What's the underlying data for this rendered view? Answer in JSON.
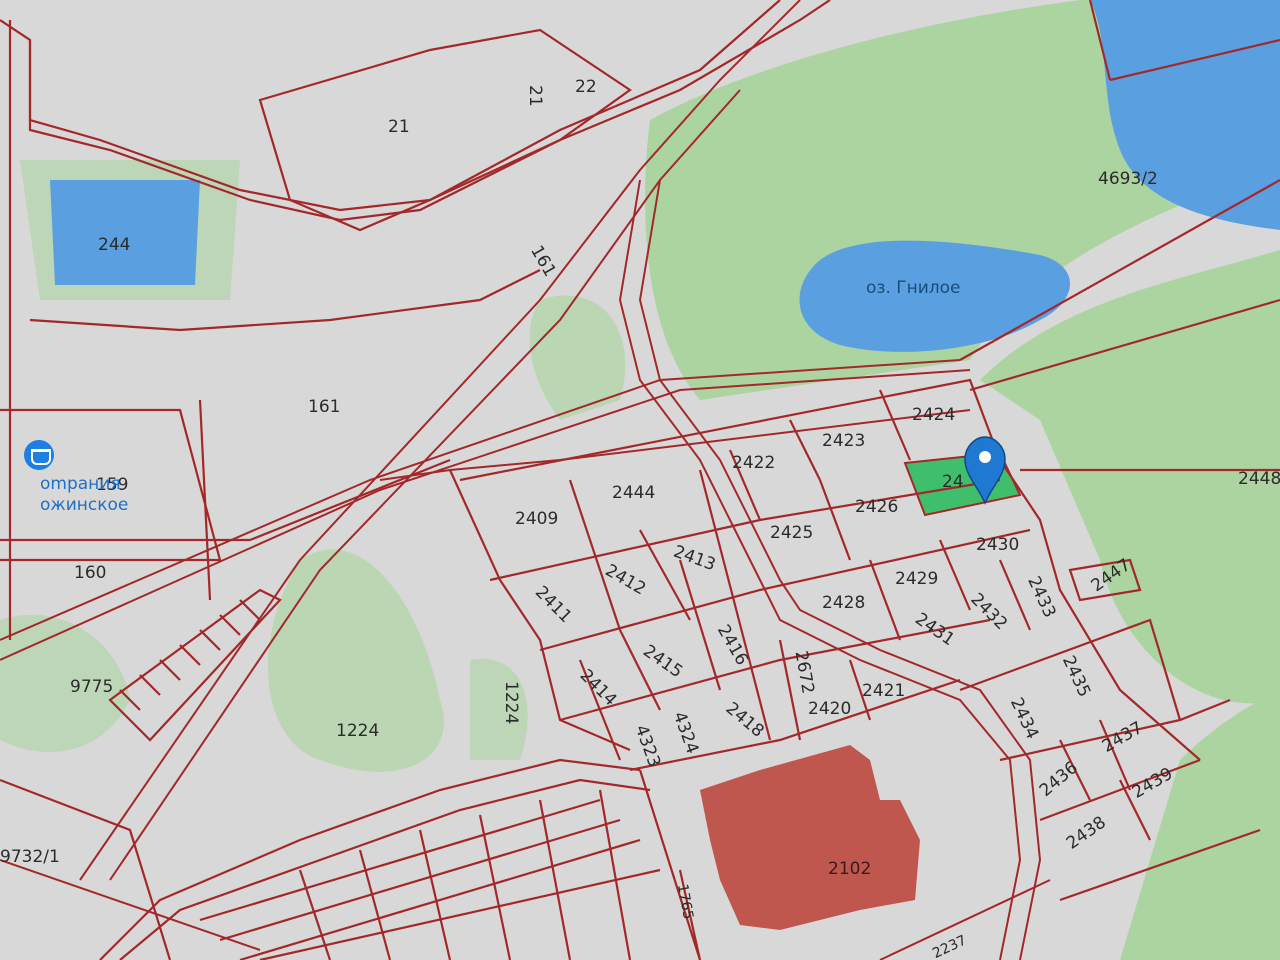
{
  "map": {
    "poi": {
      "name_line1": "ompания",
      "name_line2": "ожинское",
      "icon": "shopping-basket-icon"
    },
    "water_labels": {
      "lake": "оз. Гнилое"
    },
    "parcels": {
      "p21a": "21",
      "p21b": "21",
      "p22": "22",
      "p244": "244",
      "p161a": "161",
      "p161b": "161",
      "p159": "159",
      "p160": "160",
      "p9775": "9775",
      "p1224a": "1224",
      "p1224b": "1224",
      "p9732": "9732/1",
      "p4693": "4693/2",
      "p2448": "2448",
      "p2424": "2424",
      "p2423": "2423",
      "p2422": "2422",
      "p2444": "2444",
      "p2409": "2409",
      "p2426": "2426",
      "p2425": "2425",
      "p2413": "2413",
      "p2412": "2412",
      "p2411": "2411",
      "p2430": "2430",
      "p2429": "2429",
      "p2428": "2428",
      "p2447": "2447",
      "p2433": "2433",
      "p2432": "2432",
      "p2431": "2431",
      "p2415": "2415",
      "p2416": "2416",
      "p2414": "2414",
      "p2672": "2672",
      "p2421": "2421",
      "p2420": "2420",
      "p2418": "2418",
      "p4324": "4324",
      "p4323": "4323",
      "p2435": "2435",
      "p2434": "2434",
      "p2437": "2437",
      "p2436": "2436",
      "p2439": "2439",
      "p2438": "2438",
      "p2102": "2102",
      "p1765": "1765",
      "p2237": "2237",
      "selected": "24"
    },
    "colors": {
      "boundary": "#a3282a",
      "water": "#5aa0e0",
      "greenery": "#a7d49b",
      "selected": "#3fbf6b",
      "marker": "#1f78d1"
    }
  }
}
